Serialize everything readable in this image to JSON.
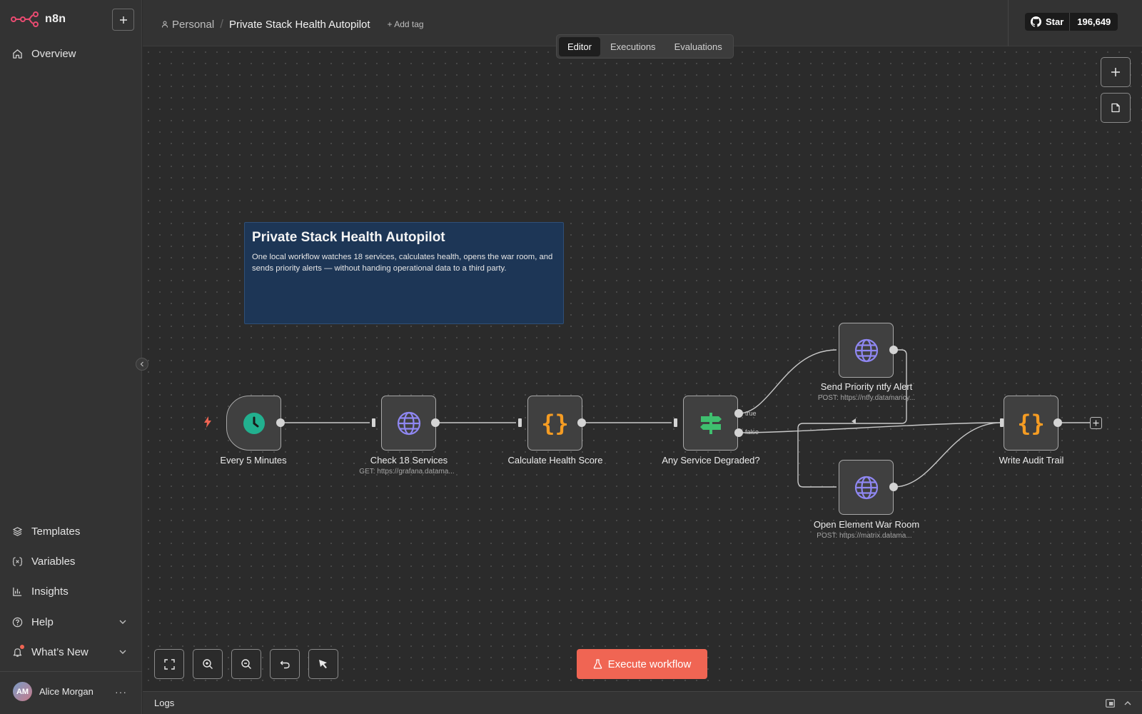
{
  "brand": {
    "name": "n8n"
  },
  "sidebar": {
    "items_top": [
      {
        "label": "Overview",
        "icon": "home-icon"
      }
    ],
    "items_bottom": [
      {
        "label": "Templates",
        "icon": "templates-icon"
      },
      {
        "label": "Variables",
        "icon": "variables-icon"
      },
      {
        "label": "Insights",
        "icon": "insights-icon"
      },
      {
        "label": "Help",
        "icon": "help-icon"
      },
      {
        "label": "What’s New",
        "icon": "bell-icon"
      }
    ],
    "user": {
      "initials": "AM",
      "name": "Alice Morgan"
    }
  },
  "header": {
    "project": "Personal",
    "workflow_name": "Private Stack Health Autopilot",
    "add_tag": "+ Add tag",
    "github": {
      "star_label": "Star",
      "count": "196,649"
    },
    "tabs": [
      "Editor",
      "Executions",
      "Evaluations"
    ],
    "active_tab": "Editor"
  },
  "sticky": {
    "title": "Private Stack Health Autopilot",
    "body": "One local workflow watches 18 services, calculates health, opens the war room, and sends priority alerts — without handing operational data to a third party."
  },
  "nodes": [
    {
      "name": "Every 5 Minutes",
      "subtitle": "",
      "icon": "clock-icon"
    },
    {
      "name": "Check 18 Services",
      "subtitle": "GET: https://grafana.datama...",
      "icon": "globe-icon"
    },
    {
      "name": "Calculate Health Score",
      "subtitle": "",
      "icon": "code-braces-icon"
    },
    {
      "name": "Any Service Degraded?",
      "subtitle": "",
      "icon": "signpost-icon"
    },
    {
      "name": "Send Priority ntfy Alert",
      "subtitle": "POST: https://ntfy.datamancy...",
      "icon": "globe-icon"
    },
    {
      "name": "Open Element War Room",
      "subtitle": "POST: https://matrix.datama...",
      "icon": "globe-icon"
    },
    {
      "name": "Write Audit Trail",
      "subtitle": "",
      "icon": "code-braces-icon"
    }
  ],
  "branches": {
    "true_label": "true",
    "false_label": "false"
  },
  "actions": {
    "execute": "Execute workflow"
  },
  "logs": {
    "title": "Logs"
  },
  "colors": {
    "accent": "#f06553",
    "trigger_icon": "#22b08f",
    "code_icon": "#f59c23",
    "http_icon": "#8f87f2",
    "if_icon": "#3fbf6f",
    "sticky_bg": "#1d3656"
  }
}
